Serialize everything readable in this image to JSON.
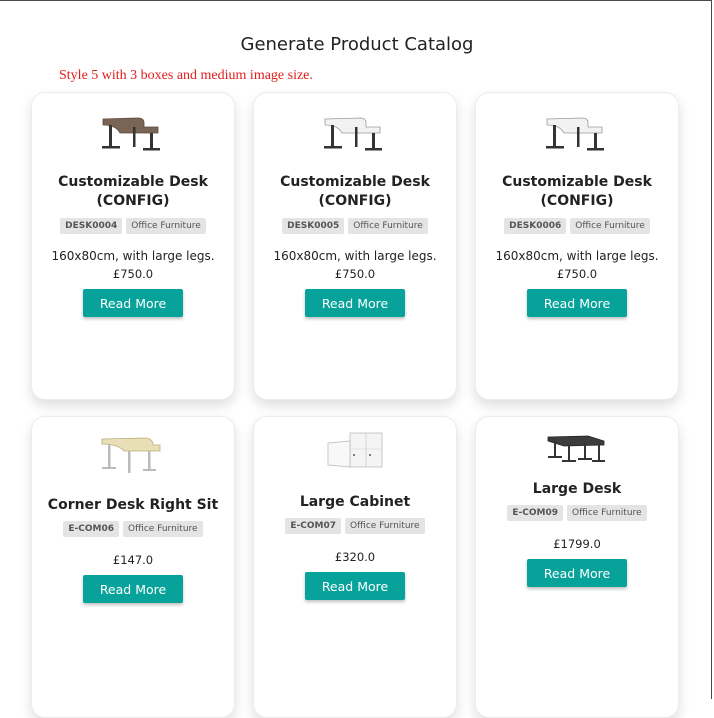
{
  "page": {
    "title": "Generate Product Catalog",
    "style_note": "Style 5 with 3 boxes and medium image size."
  },
  "products": [
    {
      "title": "Customizable Desk (CONFIG)",
      "sku": "DESK0004",
      "category": "Office Furniture",
      "description": "160x80cm, with large legs.",
      "price": "£750.0",
      "button_label": "Read More",
      "image_icon": "desk-icon",
      "desk_top_color": "#7a6455"
    },
    {
      "title": "Customizable Desk (CONFIG)",
      "sku": "DESK0005",
      "category": "Office Furniture",
      "description": "160x80cm, with large legs.",
      "price": "£750.0",
      "button_label": "Read More",
      "image_icon": "desk-icon",
      "desk_top_color": "#f2f2f2"
    },
    {
      "title": "Customizable Desk (CONFIG)",
      "sku": "DESK0006",
      "category": "Office Furniture",
      "description": "160x80cm, with large legs.",
      "price": "£750.0",
      "button_label": "Read More",
      "image_icon": "desk-icon",
      "desk_top_color": "#f2f2f2"
    },
    {
      "title": "Corner Desk Right Sit",
      "sku": "E-COM06",
      "category": "Office Furniture",
      "description": "",
      "price": "£147.0",
      "button_label": "Read More",
      "image_icon": "corner-desk-icon",
      "desk_top_color": "#e8dfb6"
    },
    {
      "title": "Large Cabinet",
      "sku": "E-COM07",
      "category": "Office Furniture",
      "description": "",
      "price": "£320.0",
      "button_label": "Read More",
      "image_icon": "cabinet-icon",
      "desk_top_color": "#f4f4f4"
    },
    {
      "title": "Large Desk",
      "sku": "E-COM09",
      "category": "Office Furniture",
      "description": "",
      "price": "£1799.0",
      "button_label": "Read More",
      "image_icon": "large-desk-icon",
      "desk_top_color": "#3c3c3c"
    }
  ],
  "colors": {
    "accent": "#07a39b",
    "note": "#e31b1b"
  }
}
